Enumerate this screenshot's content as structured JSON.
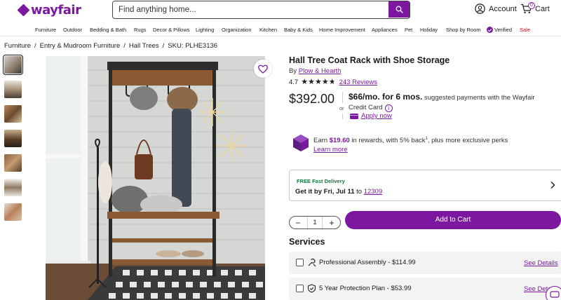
{
  "header": {
    "logo_text": "wayfair",
    "search_placeholder": "Find anything home...",
    "account_label": "Account",
    "cart_label": "Cart",
    "cart_count": "0"
  },
  "nav": [
    "Furniture",
    "Outdoor",
    "Bedding & Bath",
    "Rugs",
    "Decor & Pillows",
    "Lighting",
    "Organization",
    "Kitchen",
    "Baby & Kids",
    "Home Improvement",
    "Appliances",
    "Pet",
    "Holiday",
    "Shop by Room",
    "Verified",
    "Sale"
  ],
  "breadcrumb": {
    "items": [
      "Furniture",
      "Entry & Mudroom Furniture",
      "Hall Trees"
    ],
    "separator": "/",
    "sku": "SKU: PLHE3136"
  },
  "product": {
    "title": "Hall Tree Coat Rack with Shoe Storage",
    "brand_prefix": "By",
    "brand": "Plow & Hearth",
    "rating": "4.7",
    "rating_value": 4.7,
    "reviews": "243 Reviews",
    "price": "$392.00",
    "or": "or",
    "monthly_amount": "$66/mo. for 6 mos.",
    "monthly_text": "suggested payments with the Wayfair Credit Card",
    "apply_now": "Apply now",
    "rewards_prefix": "Earn",
    "rewards_amount": "$19.60",
    "rewards_text": "in rewards, with 5% back",
    "rewards_sup": "1",
    "rewards_suffix": ", plus more exclusive perks",
    "learn_more": "Learn more"
  },
  "delivery": {
    "tag": "FREE Fast Delivery",
    "get_it_prefix": "Get it by",
    "date": "Fri, Jul 11",
    "to": "to",
    "zip": "12309"
  },
  "purchase": {
    "quantity": "1",
    "minus": "−",
    "plus": "+",
    "add_to_cart": "Add to Cart"
  },
  "services": {
    "heading": "Services",
    "items": [
      {
        "label": "Professional Assembly - $114.99",
        "link": "See Details"
      },
      {
        "label": "5 Year Protection Plan - $53.99",
        "link": "See Details"
      }
    ]
  },
  "colors": {
    "brand": "#7b189f",
    "delivery_green": "#0b7d3e",
    "sale_red": "#d0021b"
  }
}
